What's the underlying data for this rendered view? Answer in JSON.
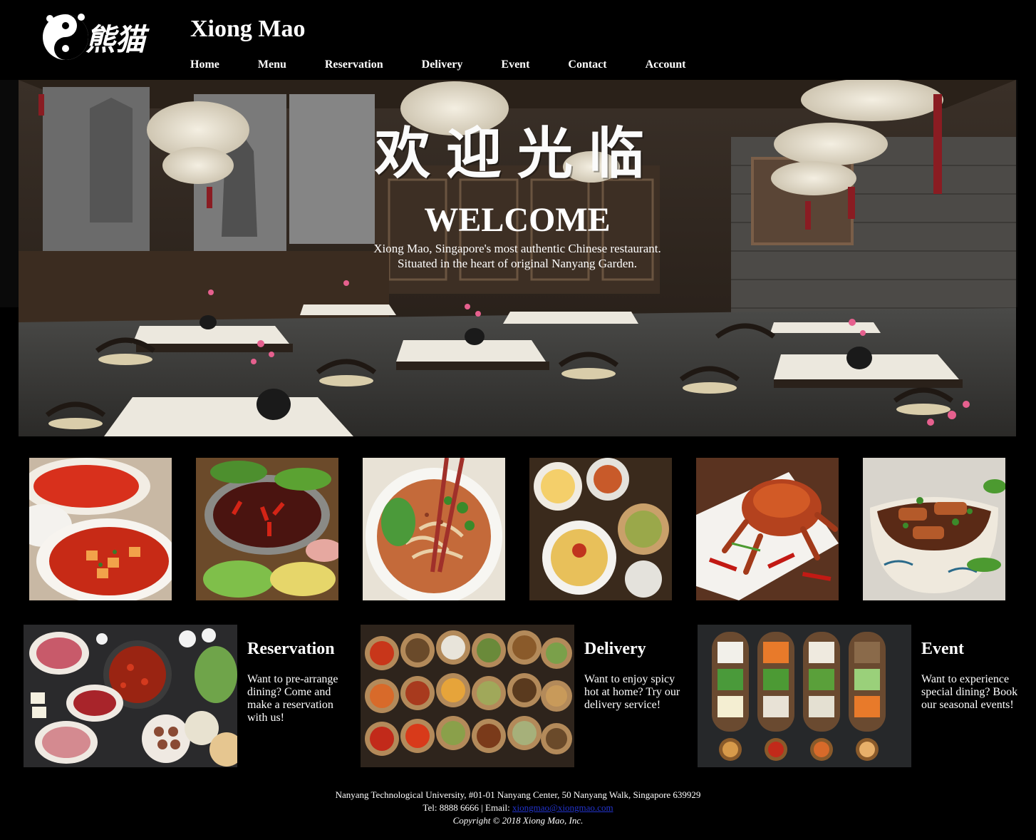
{
  "header": {
    "brand": "Xiong Mao",
    "logo_text": "熊猫",
    "nav": [
      "Home",
      "Menu",
      "Reservation",
      "Delivery",
      "Event",
      "Contact",
      "Account"
    ]
  },
  "hero": {
    "chinese_title": "欢迎光临",
    "title": "WELCOME",
    "line1": "Xiong Mao, Singapore's most authentic Chinese restaurant.",
    "line2": "Situated in the heart of original Nanyang Garden."
  },
  "gallery": {
    "icons": [
      "mapo-tofu-photo",
      "hot-pot-photo",
      "noodle-bowl-photo",
      "dim-sum-platter-photo",
      "chili-crab-photo",
      "braised-eggplant-photo"
    ]
  },
  "promos": [
    {
      "title": "Reservation",
      "text": "Want to pre-arrange dining? Come and make a reservation with us!"
    },
    {
      "title": "Delivery",
      "text": "Want to enjoy spicy hot at home? Try our delivery service!"
    },
    {
      "title": "Event",
      "text": "Want to experience special dining? Book our seasonal events!"
    }
  ],
  "footer": {
    "address": "Nanyang Technological University, #01-01 Nanyang Center, 50 Nanyang Walk, Singapore 639929",
    "tel_label": "Tel: 8888 6666 | Email: ",
    "email": "xiongmao@xiongmao.com",
    "copyright": "Copyright © 2018 Xiong Mao, Inc."
  },
  "colors": {
    "background": "#000000",
    "text": "#ffffff",
    "link": "#2233cc"
  }
}
